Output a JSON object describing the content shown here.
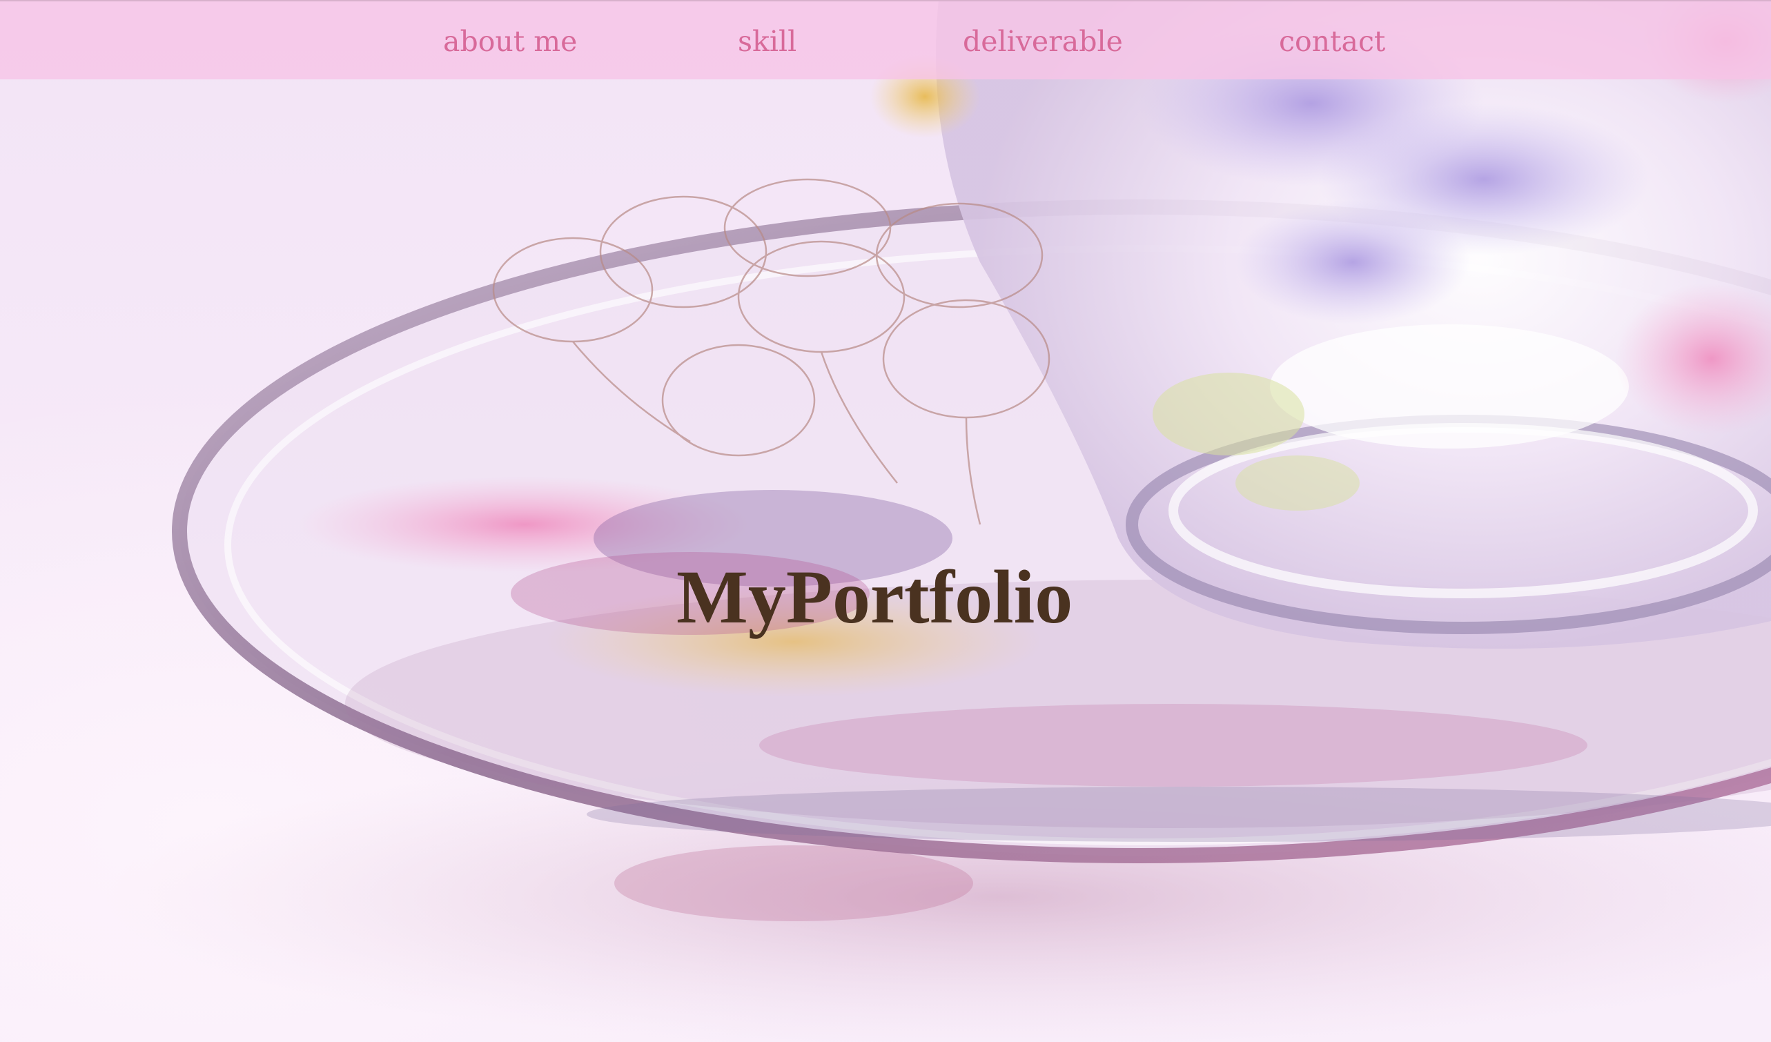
{
  "nav": {
    "items": [
      {
        "label": "about me"
      },
      {
        "label": "skill"
      },
      {
        "label": "deliverable"
      },
      {
        "label": "contact"
      }
    ]
  },
  "hero": {
    "title": "MyPortfolio",
    "background_image": "glass-teacup-and-saucer-photo"
  },
  "colors": {
    "nav_background": "#f6c4e6",
    "nav_text": "#d86a9a",
    "title_text": "#4a3220",
    "page_background": "#f7ebf7"
  }
}
